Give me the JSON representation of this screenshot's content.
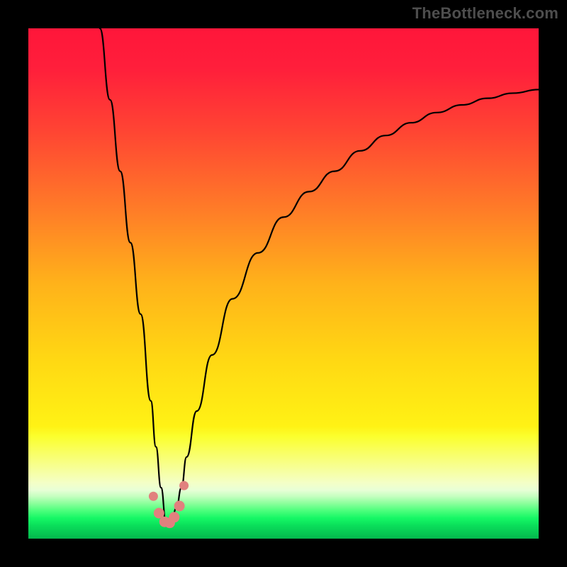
{
  "watermark": "TheBottleneck.com",
  "colors": {
    "frame": "#000000",
    "watermark": "#4e4e4e",
    "curve": "#000000",
    "marker_fill": "#e1807e",
    "gradient_stops": [
      {
        "offset": 0.0,
        "color": "#ff163a"
      },
      {
        "offset": 0.08,
        "color": "#ff1f3b"
      },
      {
        "offset": 0.2,
        "color": "#ff4433"
      },
      {
        "offset": 0.35,
        "color": "#ff7a28"
      },
      {
        "offset": 0.5,
        "color": "#ffb21a"
      },
      {
        "offset": 0.65,
        "color": "#ffd813"
      },
      {
        "offset": 0.78,
        "color": "#fff215"
      },
      {
        "offset": 0.8,
        "color": "#fbff2e"
      },
      {
        "offset": 0.83,
        "color": "#f9ff62"
      },
      {
        "offset": 0.86,
        "color": "#f7ff94"
      },
      {
        "offset": 0.89,
        "color": "#f4ffc6"
      },
      {
        "offset": 0.905,
        "color": "#e8ffd6"
      },
      {
        "offset": 0.917,
        "color": "#c5ffc0"
      },
      {
        "offset": 0.93,
        "color": "#8fff9e"
      },
      {
        "offset": 0.945,
        "color": "#4dff7c"
      },
      {
        "offset": 0.96,
        "color": "#15f765"
      },
      {
        "offset": 0.975,
        "color": "#0add5a"
      },
      {
        "offset": 1.0,
        "color": "#04b74d"
      }
    ]
  },
  "chart_data": {
    "type": "line",
    "title": "",
    "xlabel": "",
    "ylabel": "",
    "xlim": [
      0,
      100
    ],
    "ylim": [
      0,
      100
    ],
    "note": "V-shaped bottleneck curve; minimum near x≈27. Values are read from pixel positions (no axis labels present).",
    "series": [
      {
        "name": "bottleneck-curve",
        "x": [
          14,
          16,
          18,
          20,
          22,
          24,
          25,
          26,
          27,
          28,
          29,
          30,
          31,
          33,
          36,
          40,
          45,
          50,
          55,
          60,
          65,
          70,
          75,
          80,
          85,
          90,
          95,
          100
        ],
        "y": [
          100,
          86,
          72,
          58,
          44,
          27,
          18,
          10,
          3,
          3,
          6,
          10,
          16,
          25,
          36,
          47,
          56,
          63,
          68,
          72,
          76,
          79,
          81.5,
          83.5,
          85,
          86.3,
          87.3,
          88
        ]
      }
    ],
    "markers": {
      "name": "highlight-dots",
      "x": [
        24.5,
        25.6,
        26.7,
        27.7,
        28.6,
        29.6,
        30.5
      ],
      "y": [
        8.3,
        5.0,
        3.3,
        3.1,
        4.2,
        6.4,
        10.4
      ]
    }
  }
}
